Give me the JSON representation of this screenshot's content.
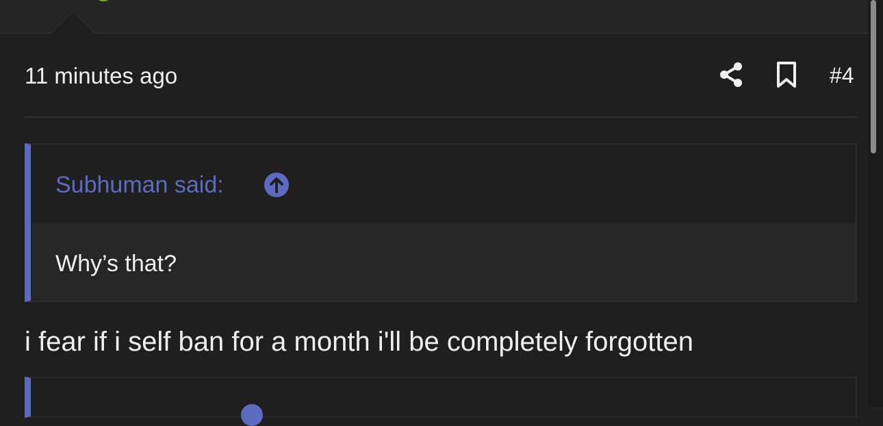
{
  "post": {
    "timestamp": "11 minutes ago",
    "post_number": "#4",
    "share_icon": "share-icon",
    "bookmark_icon": "bookmark-icon"
  },
  "quote": {
    "author_label": "Subhuman said:",
    "text": "Why’s that?",
    "jump_icon": "arrow-up-circle-icon"
  },
  "message": {
    "text": "i fear if i self ban for a month i'll be completely forgotten"
  },
  "colors": {
    "background": "#1f1f1f",
    "accent": "#5c6bc0",
    "text": "#f0f0f0"
  }
}
